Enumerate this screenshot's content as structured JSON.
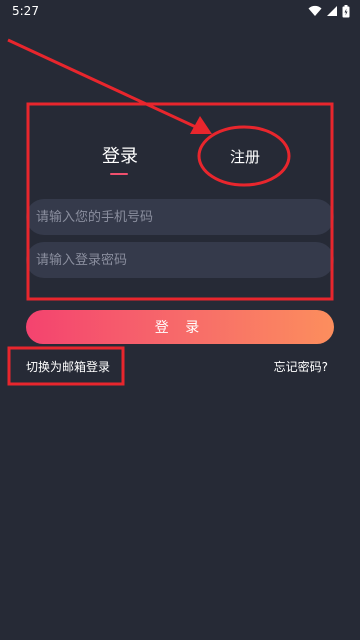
{
  "status_bar": {
    "time": "5:27"
  },
  "tabs": {
    "login": "登录",
    "register": "注册"
  },
  "form": {
    "phone_placeholder": "请输入您的手机号码",
    "password_placeholder": "请输入登录密码",
    "login_button": "登 录"
  },
  "links": {
    "switch_email": "切换为邮箱登录",
    "forgot_password": "忘记密码?"
  },
  "colors": {
    "background": "#262a36",
    "accent": "#f0506e",
    "annotation": "#e8262d"
  }
}
